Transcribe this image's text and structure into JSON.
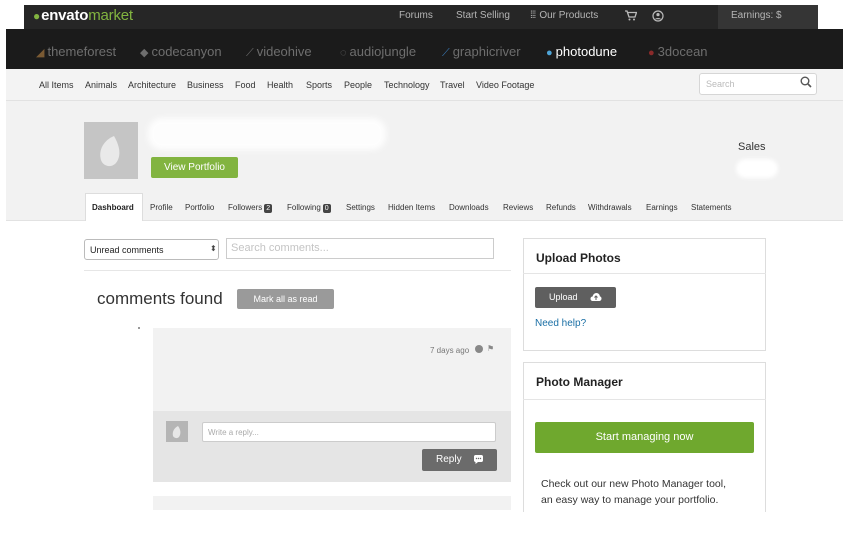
{
  "brand": {
    "envato": "envato",
    "market": "market"
  },
  "top_nav": {
    "forums": "Forums",
    "start_selling": "Start Selling",
    "our_products": "Our Products",
    "earnings": "Earnings: $"
  },
  "marketplaces": [
    {
      "name": "themeforest",
      "icon": "leaf-icon"
    },
    {
      "name": "codecanyon",
      "icon": "code-icon"
    },
    {
      "name": "videohive",
      "icon": "video-icon"
    },
    {
      "name": "audiojungle",
      "icon": "audio-icon"
    },
    {
      "name": "graphicriver",
      "icon": "pen-icon"
    },
    {
      "name": "photodune",
      "icon": "photo-icon"
    },
    {
      "name": "3docean",
      "icon": "3d-icon"
    }
  ],
  "active_marketplace": "photodune",
  "categories": [
    "All Items",
    "Animals",
    "Architecture",
    "Business",
    "Food",
    "Health",
    "Sports",
    "People",
    "Technology",
    "Travel",
    "Video Footage"
  ],
  "search": {
    "placeholder": "Search"
  },
  "profile": {
    "view_portfolio": "View Portfolio",
    "sales_label": "Sales"
  },
  "tabs": [
    {
      "label": "Dashboard",
      "active": true
    },
    {
      "label": "Profile"
    },
    {
      "label": "Portfolio"
    },
    {
      "label": "Followers",
      "badge": "2"
    },
    {
      "label": "Following",
      "badge": "0"
    },
    {
      "label": "Settings"
    },
    {
      "label": "Hidden Items"
    },
    {
      "label": "Downloads"
    },
    {
      "label": "Reviews"
    },
    {
      "label": "Refunds"
    },
    {
      "label": "Withdrawals"
    },
    {
      "label": "Earnings"
    },
    {
      "label": "Statements"
    }
  ],
  "comments": {
    "filter_value": "Unread comments",
    "search_placeholder": "Search comments...",
    "found_text": "comments found",
    "mark_all_read": "Mark all as read",
    "item_time": "7 days ago",
    "reply_placeholder": "Write a reply...",
    "reply_button": "Reply"
  },
  "upload_widget": {
    "title": "Upload Photos",
    "button": "Upload",
    "help": "Need help?"
  },
  "photo_manager": {
    "title": "Photo Manager",
    "button": "Start managing now",
    "line1": "Check out our new Photo Manager tool,",
    "line2": "an easy way to manage your portfolio."
  },
  "colors": {
    "accent_green": "#82b440",
    "top_bar": "#262626",
    "market_bar": "#1b1b1b",
    "link_blue": "#1a6fa5"
  }
}
